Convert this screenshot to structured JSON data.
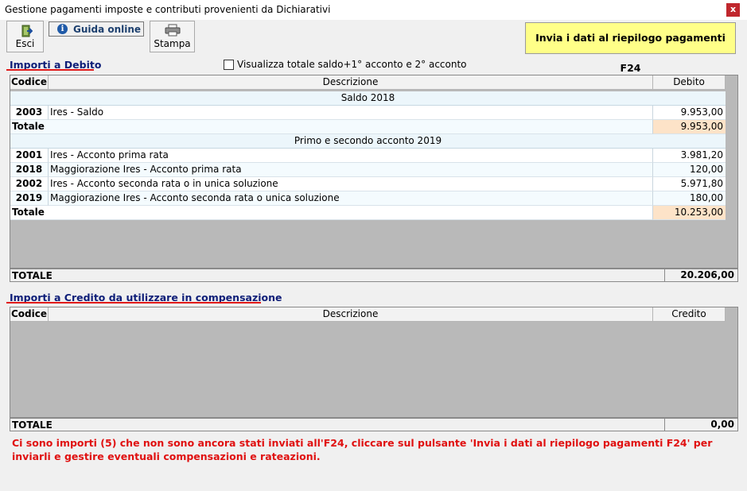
{
  "window": {
    "title": "Gestione pagamenti imposte e contributi provenienti da Dichiarativi",
    "close_label": "x"
  },
  "toolbar": {
    "exit_label": "Esci",
    "guide_label": "Guida online",
    "print_label": "Stampa",
    "f24_button_label": "Invia i dati al riepilogo pagamenti F24"
  },
  "debito": {
    "title": "Importi a Debito",
    "checkbox_label": "Visualizza totale saldo+1° acconto e 2° acconto",
    "columns": {
      "code": "Codice",
      "desc": "Descrizione",
      "amount": "Debito"
    },
    "group1": {
      "title": "Saldo 2018",
      "rows": [
        {
          "code": "2003",
          "desc": "Ires - Saldo",
          "amount": "9.953,00"
        }
      ],
      "total_label": "Totale",
      "total_value": "9.953,00"
    },
    "group2": {
      "title": "Primo e secondo acconto 2019",
      "rows": [
        {
          "code": "2001",
          "desc": "Ires - Acconto prima rata",
          "amount": "3.981,20"
        },
        {
          "code": "2018",
          "desc": "Maggiorazione Ires - Acconto prima rata",
          "amount": "120,00"
        },
        {
          "code": "2002",
          "desc": "Ires - Acconto seconda rata o in unica soluzione",
          "amount": "5.971,80"
        },
        {
          "code": "2019",
          "desc": "Maggiorazione Ires - Acconto seconda rata o unica soluzione",
          "amount": "180,00"
        }
      ],
      "total_label": "Totale",
      "total_value": "10.253,00"
    },
    "grand_total_label": "TOTALE",
    "grand_total_value": "20.206,00"
  },
  "credito": {
    "title": "Importi a Credito da utilizzare in compensazione",
    "columns": {
      "code": "Codice",
      "desc": "Descrizione",
      "amount": "Credito"
    },
    "grand_total_label": "TOTALE",
    "grand_total_value": "0,00"
  },
  "warning": "Ci sono importi (5) che non sono ancora stati inviati all'F24, cliccare sul pulsante 'Invia i dati al riepilogo pagamenti F24' per inviarli e gestire eventuali compensazioni e rateazioni."
}
